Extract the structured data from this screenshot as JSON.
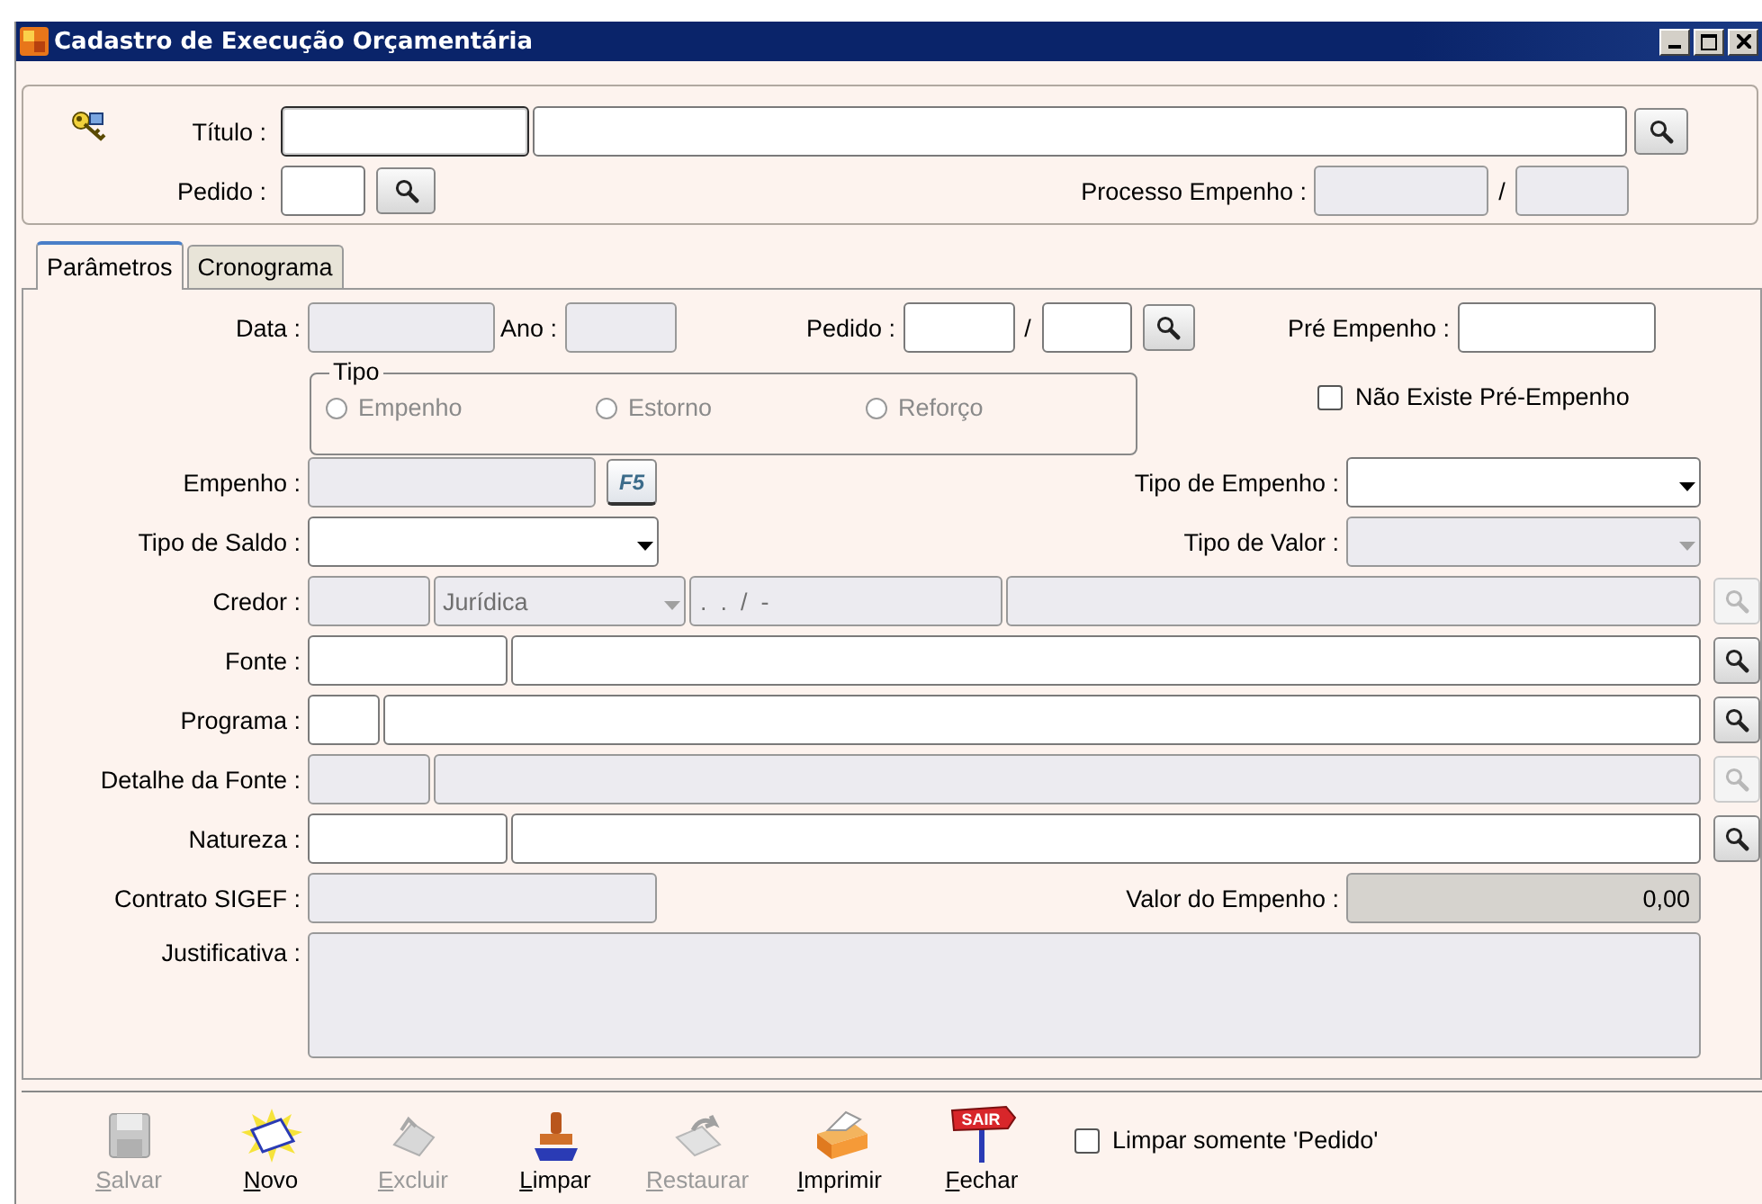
{
  "window": {
    "title": "Cadastro de Execução Orçamentária"
  },
  "header": {
    "titulo": {
      "label": "Título :",
      "code": {
        "disabled": false,
        "focused": true
      },
      "text": {
        "disabled": false
      },
      "search": {
        "disabled": false
      }
    },
    "pedido": {
      "label": "Pedido :",
      "field": {
        "disabled": false
      },
      "search": {
        "disabled": false
      }
    },
    "processo": {
      "label": "Processo Empenho :",
      "number": {
        "disabled": true
      },
      "separator": "/",
      "year": {
        "disabled": true
      }
    }
  },
  "tabs": [
    {
      "label": "Parâmetros",
      "selected": true
    },
    {
      "label": "Cronograma",
      "selected": false
    }
  ],
  "form": {
    "data": {
      "label": "Data :",
      "field": {
        "disabled": true
      }
    },
    "ano": {
      "label": "Ano :",
      "field": {
        "disabled": true
      }
    },
    "pedido": {
      "label": "Pedido :",
      "number": {
        "disabled": false
      },
      "separator": "/",
      "year": {
        "disabled": false
      },
      "search": {
        "disabled": false
      }
    },
    "pre_empenho": {
      "label": "Pré Empenho :",
      "field": {
        "disabled": false
      }
    },
    "tipo": {
      "legend": "Tipo",
      "options": [
        {
          "label": "Empenho",
          "selected": false,
          "disabled": true
        },
        {
          "label": "Estorno",
          "selected": false,
          "disabled": true
        },
        {
          "label": "Reforço",
          "selected": false,
          "disabled": true
        }
      ]
    },
    "nao_existe": {
      "label": "Não Existe Pré-Empenho",
      "checked": false
    },
    "empenho": {
      "label": "Empenho :",
      "field": {
        "disabled": true
      },
      "key": "F5"
    },
    "tipo_empenho": {
      "label": "Tipo de Empenho :",
      "select": {
        "disabled": false
      }
    },
    "tipo_saldo": {
      "label": "Tipo de Saldo :",
      "select": {
        "disabled": false
      }
    },
    "tipo_valor": {
      "label": "Tipo de Valor :",
      "select": {
        "disabled": true
      }
    },
    "credor": {
      "label": "Credor :",
      "code": {
        "disabled": true
      },
      "person_type": {
        "value": "Jurídica",
        "disabled": true
      },
      "document": {
        "value": ".  .  /  -",
        "disabled": true
      },
      "name": {
        "disabled": true
      },
      "search": {
        "disabled": true
      }
    },
    "fonte": {
      "label": "Fonte :",
      "code": {
        "disabled": false
      },
      "text": {
        "disabled": false
      },
      "search": {
        "disabled": false
      }
    },
    "programa": {
      "label": "Programa :",
      "code": {
        "disabled": false
      },
      "text": {
        "disabled": false
      },
      "search": {
        "disabled": false
      }
    },
    "detalhe": {
      "label": "Detalhe da Fonte :",
      "code": {
        "disabled": true
      },
      "text": {
        "disabled": true
      },
      "search": {
        "disabled": true
      }
    },
    "natureza": {
      "label": "Natureza :",
      "code": {
        "disabled": false
      },
      "text": {
        "disabled": false
      },
      "search": {
        "disabled": false
      }
    },
    "contrato": {
      "label": "Contrato SIGEF :",
      "field": {
        "disabled": true
      }
    },
    "valor": {
      "label": "Valor do Empenho :",
      "field": {
        "value": "0,00",
        "disabled": true
      }
    },
    "justificativa": {
      "label": "Justificativa :",
      "field": {
        "disabled": true
      }
    }
  },
  "toolbar": {
    "buttons": [
      {
        "kind": "save",
        "label": "Salvar",
        "disabled": true
      },
      {
        "kind": "new",
        "label": "Novo",
        "disabled": false
      },
      {
        "kind": "delete",
        "label": "Excluir",
        "disabled": true
      },
      {
        "kind": "clear",
        "label": "Limpar",
        "disabled": false
      },
      {
        "kind": "restore",
        "label": "Restaurar",
        "disabled": true
      },
      {
        "kind": "print",
        "label": "Imprimir",
        "disabled": false
      },
      {
        "kind": "close",
        "label": "Fechar",
        "disabled": false,
        "sign": "SAIR"
      }
    ],
    "limpar_pedido": {
      "label": "Limpar somente 'Pedido'",
      "checked": false
    }
  }
}
